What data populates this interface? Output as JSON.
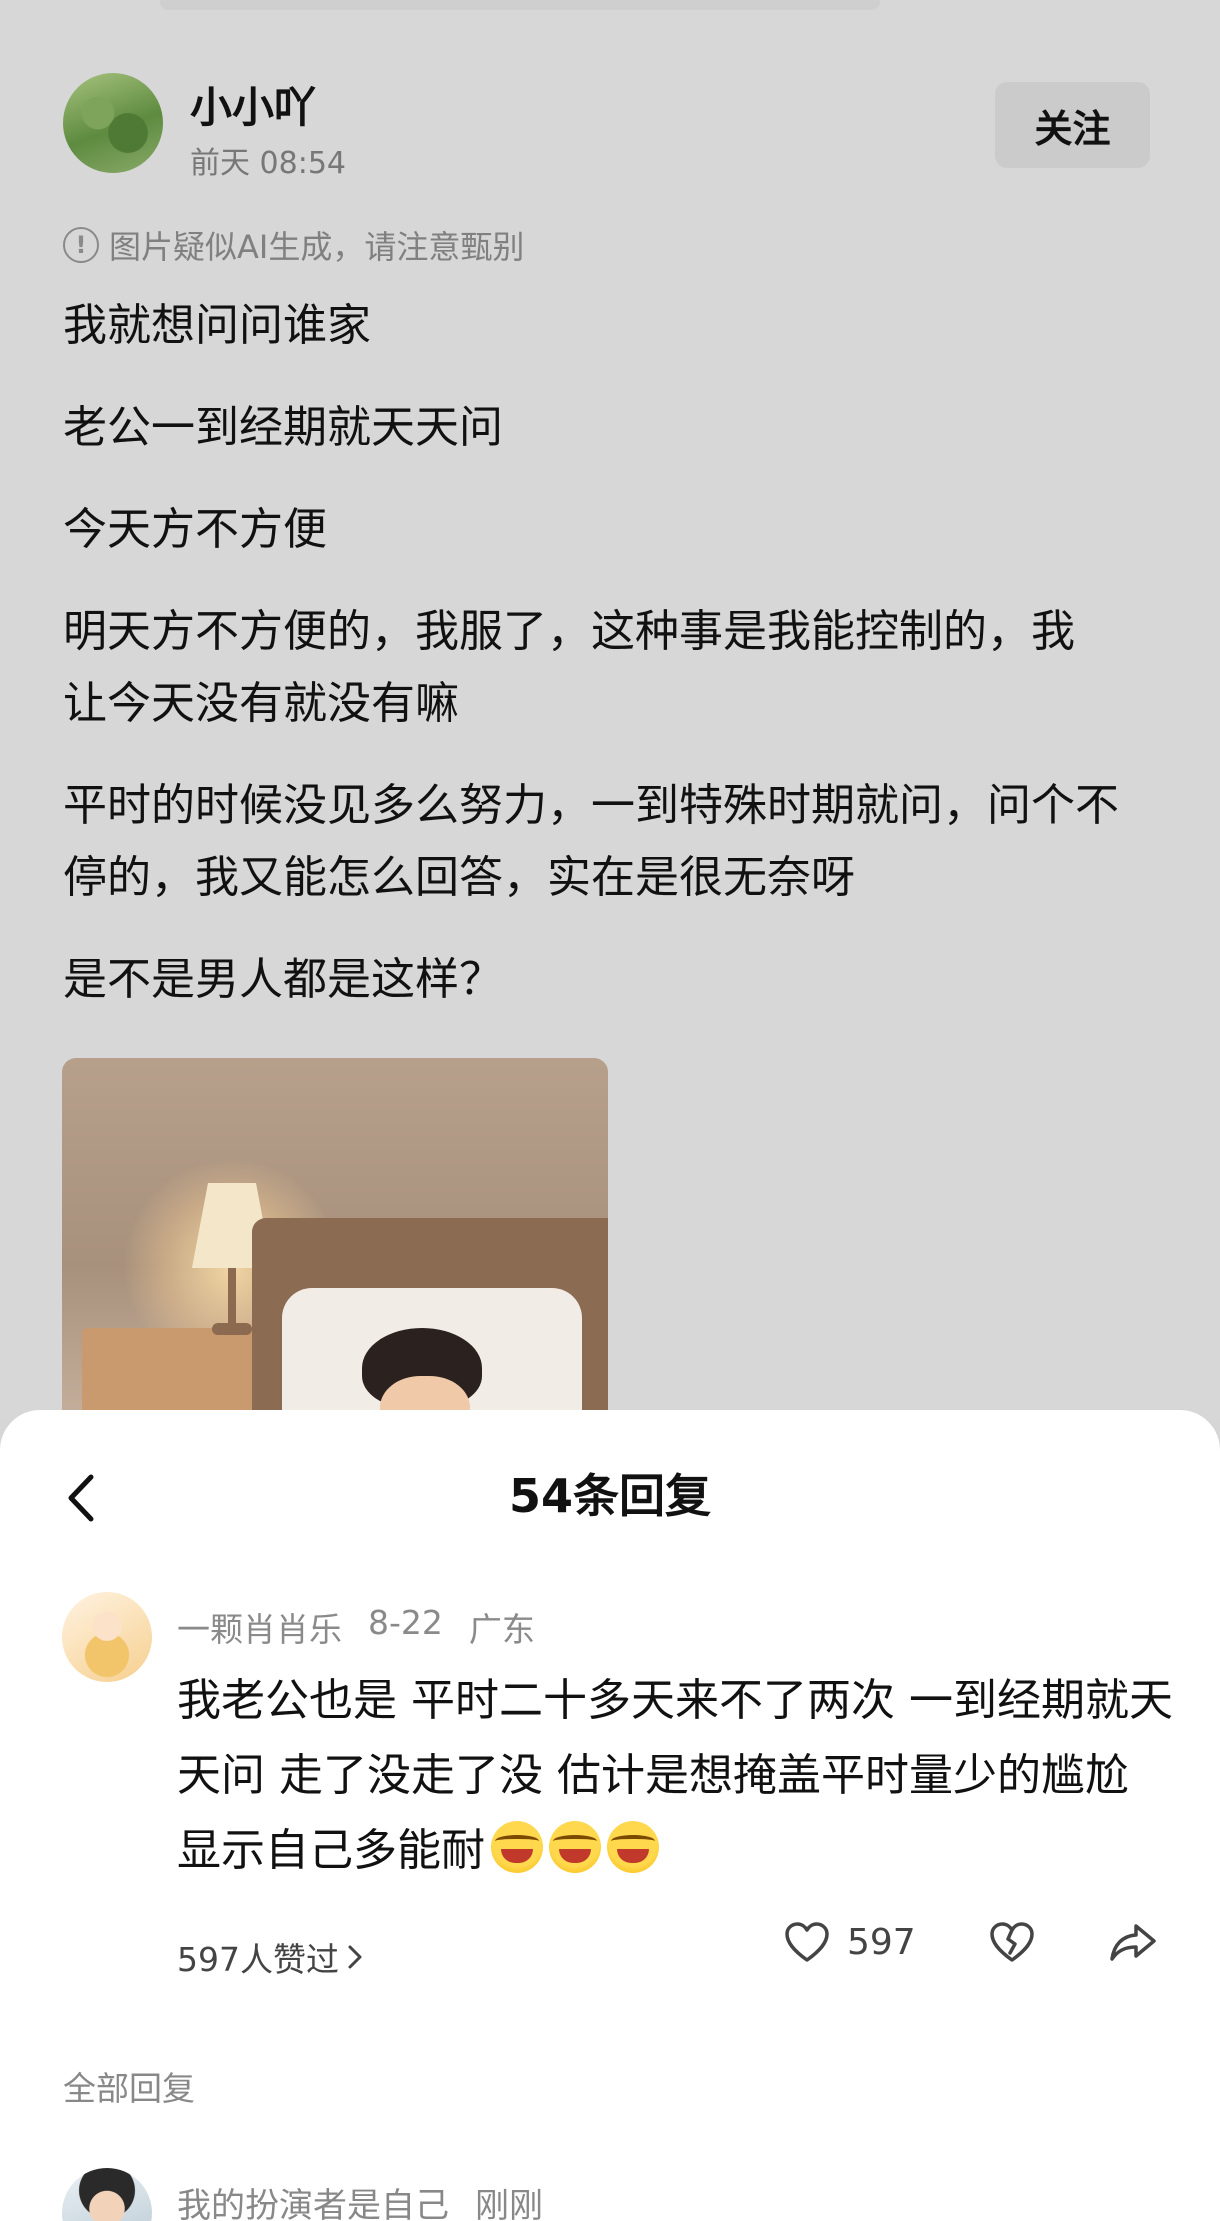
{
  "post": {
    "author": "小小吖",
    "time": "前天 08:54",
    "follow_label": "关注",
    "ai_notice": "图片疑似AI生成，请注意甄别",
    "paragraphs": [
      "我就想问问谁家",
      "老公一到经期就天天问",
      "今天方不方便",
      "明天方不方便的，我服了，这种事是我能控制的，我让今天没有就没有嘛",
      "平时的时候没见多么努力，一到特殊时期就问，问个不停的，我又能怎么回答，实在是很无奈呀",
      "是不是男人都是这样？"
    ]
  },
  "sheet": {
    "title": "54条回复",
    "featured_comment": {
      "username": "一颗肖肖乐",
      "date": "8-22",
      "location": "广东",
      "text": "我老公也是 平时二十多天来不了两次 一到经期就天天问 走了没走了没 估计是想掩盖平时量少的尴尬 显示自己多能耐",
      "likes_link": "597人赞过",
      "like_count": "597"
    },
    "all_replies_label": "全部回复",
    "reply": {
      "username": "我的扮演者是自己",
      "time": "刚刚"
    }
  },
  "colors": {
    "overlay_bg": "#d7d7d7",
    "sheet_bg": "#ffffff",
    "muted_text": "#8a8a8a"
  }
}
